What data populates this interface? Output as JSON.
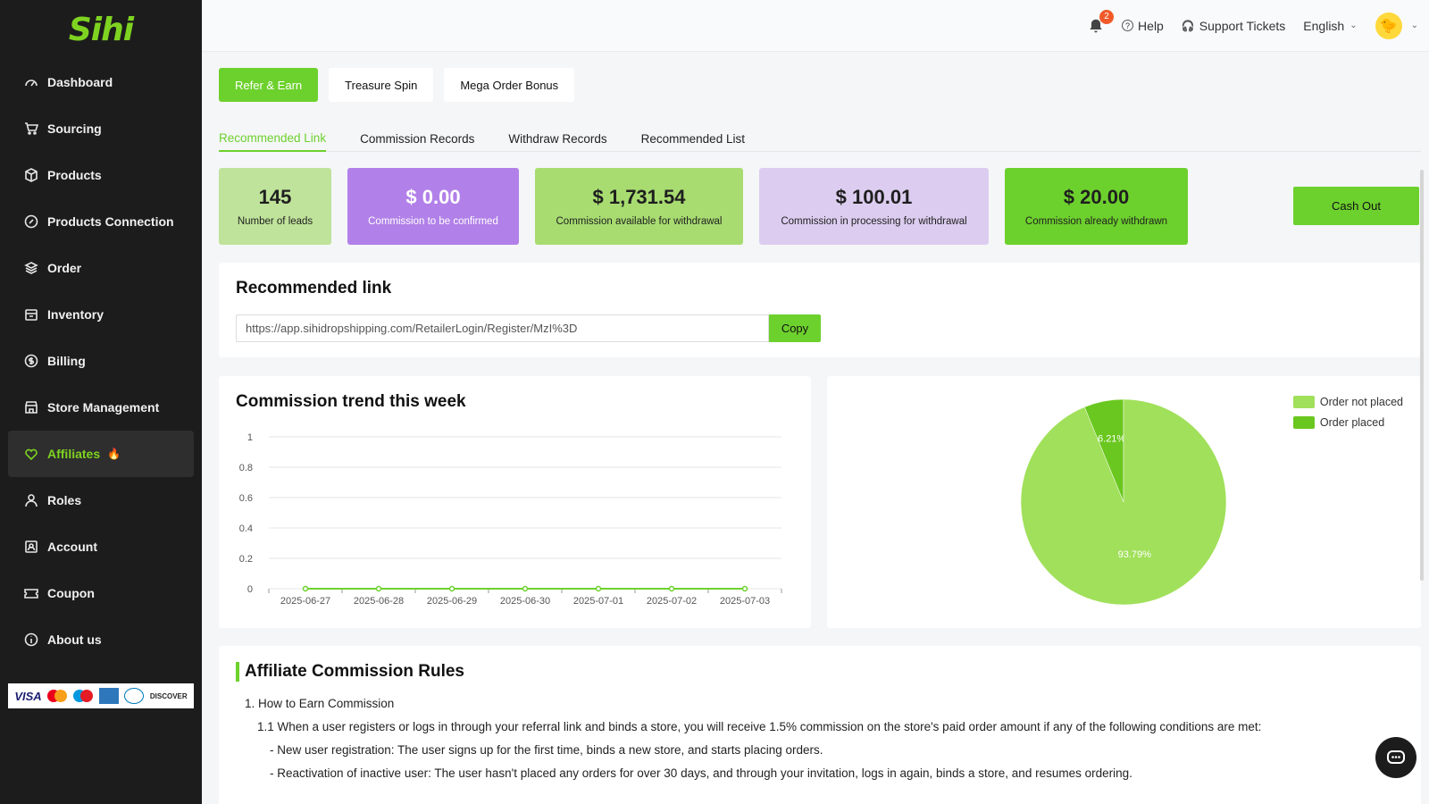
{
  "logo": "Sihi",
  "sidebar": {
    "items": [
      {
        "label": "Dashboard",
        "icon": "dashboard-icon"
      },
      {
        "label": "Sourcing",
        "icon": "cart-icon"
      },
      {
        "label": "Products",
        "icon": "box-icon"
      },
      {
        "label": "Products Connection",
        "icon": "link-icon"
      },
      {
        "label": "Order",
        "icon": "layers-icon"
      },
      {
        "label": "Inventory",
        "icon": "inventory-icon"
      },
      {
        "label": "Billing",
        "icon": "dollar-icon"
      },
      {
        "label": "Store Management",
        "icon": "store-icon"
      },
      {
        "label": "Affiliates",
        "icon": "heart-icon",
        "active": true
      },
      {
        "label": "Roles",
        "icon": "user-icon"
      },
      {
        "label": "Account",
        "icon": "account-icon"
      },
      {
        "label": "Coupon",
        "icon": "ticket-icon"
      },
      {
        "label": "About us",
        "icon": "info-icon"
      }
    ],
    "payment_cards": [
      "VISA",
      "Mastercard",
      "Maestro",
      "AMEX",
      "Diners Club",
      "DISCOVER"
    ]
  },
  "topbar": {
    "notification_count": "2",
    "help": "Help",
    "support": "Support Tickets",
    "language": "English"
  },
  "top_tabs": [
    "Refer & Earn",
    "Treasure Spin",
    "Mega Order Bonus"
  ],
  "sub_tabs": [
    "Recommended Link",
    "Commission Records",
    "Withdraw Records",
    "Recommended List"
  ],
  "stats": [
    {
      "value": "145",
      "label": "Number of leads"
    },
    {
      "value": "$ 0.00",
      "label": "Commission to be confirmed"
    },
    {
      "value": "$ 1,731.54",
      "label": "Commission available for withdrawal"
    },
    {
      "value": "$ 100.01",
      "label": "Commission in processing for withdrawal"
    },
    {
      "value": "$ 20.00",
      "label": "Commission already withdrawn"
    }
  ],
  "cash_out_label": "Cash Out",
  "recommended_link": {
    "title": "Recommended link",
    "url": "https://app.sihidropshipping.com/RetailerLogin/Register/MzI%3D",
    "copy_label": "Copy"
  },
  "colors": {
    "accent": "#6dd12d",
    "purple": "#b180e8",
    "sidebar_bg": "#1c1c1c"
  },
  "chart_data": [
    {
      "type": "line",
      "title": "Commission trend this week",
      "x": [
        "2025-06-27",
        "2025-06-28",
        "2025-06-29",
        "2025-06-30",
        "2025-07-01",
        "2025-07-02",
        "2025-07-03"
      ],
      "series": [
        {
          "values": [
            0,
            0,
            0,
            0,
            0,
            0,
            0
          ]
        }
      ],
      "ylim": [
        0,
        1
      ],
      "yticks": [
        "0",
        "0.2",
        "0.4",
        "0.6",
        "0.8",
        "1"
      ],
      "grid": true
    },
    {
      "type": "pie",
      "labels": [
        "Order not placed",
        "Order placed"
      ],
      "values": [
        93.79,
        6.21
      ],
      "value_labels": [
        "93.79%",
        "6.21%"
      ],
      "colors": [
        "#a1e05b",
        "#6ac71f"
      ],
      "legend_position": "top-right"
    }
  ],
  "rules": {
    "title": "Affiliate Commission Rules",
    "lines": [
      "1. How to Earn Commission",
      "1.1 When a user registers or logs in through your referral link and binds a store, you will receive 1.5% commission on the store's paid order amount if any of the following conditions are met:",
      "- New user registration: The user signs up for the first time, binds a new store, and starts placing orders.",
      "- Reactivation of inactive user: The user hasn't placed any orders for over 30 days, and through your invitation, logs in again, binds a store, and resumes ordering."
    ]
  }
}
